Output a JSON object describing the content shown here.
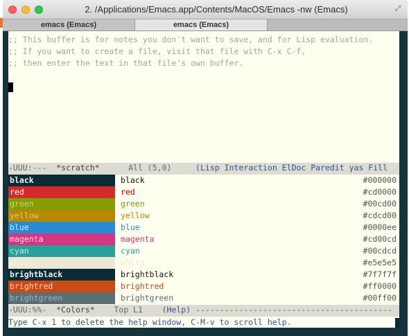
{
  "window": {
    "title": "2. /Applications/Emacs.app/Contents/MacOS/Emacs -nw (Emacs)",
    "tabs": [
      "emacs (Emacs)",
      "emacs (Emacs)"
    ]
  },
  "scratch": {
    "lines": [
      ";; This buffer is for notes you don't want to save, and for Lisp evaluation.",
      ";; If you want to create a file, visit that file with C-x C-f,",
      ";; then enter the text in that file's own buffer."
    ]
  },
  "modeline1": {
    "status": "-UUU:---",
    "buffer": "*scratch*",
    "position": "All (5,0)",
    "modes": "(Lisp Interaction ElDoc Paredit yas Fill"
  },
  "colors": [
    {
      "name": "black",
      "hex": "#000000",
      "swatch_bg": "#0b2a34",
      "swatch_fg": "#eeeeee",
      "text_color": "#111111",
      "bold": true
    },
    {
      "name": "red",
      "hex": "#cd0000",
      "swatch_bg": "#d42a2a",
      "swatch_fg": "#ffffff",
      "text_color": "#cd0000",
      "bold": false
    },
    {
      "name": "green",
      "hex": "#00cd00",
      "swatch_bg": "#859d00",
      "swatch_fg": "#c8d88a",
      "text_color": "#7a9a00",
      "bold": false
    },
    {
      "name": "yellow",
      "hex": "#cdcd00",
      "swatch_bg": "#b68900",
      "swatch_fg": "#e0c880",
      "text_color": "#b58900",
      "bold": false
    },
    {
      "name": "blue",
      "hex": "#0000ee",
      "swatch_bg": "#2a8bd2",
      "swatch_fg": "#d9ecf8",
      "text_color": "#2a8bd2",
      "bold": false
    },
    {
      "name": "magenta",
      "hex": "#cd00cd",
      "swatch_bg": "#d33682",
      "swatch_fg": "#fde0ee",
      "text_color": "#d33682",
      "bold": false
    },
    {
      "name": "cyan",
      "hex": "#00cdcd",
      "swatch_bg": "#2aa198",
      "swatch_fg": "#c8ece8",
      "text_color": "#2aa198",
      "bold": false
    },
    {
      "name": "white",
      "hex": "#e5e5e5",
      "swatch_bg": "#ede8d5",
      "swatch_fg": "#f8f5ea",
      "text_color": "#eee8d5",
      "bold": false
    },
    {
      "name": "brightblack",
      "hex": "#7f7f7f",
      "swatch_bg": "#0b2a34",
      "swatch_fg": "#eeeeee",
      "text_color": "#111111",
      "bold": true
    },
    {
      "name": "brightred",
      "hex": "#ff0000",
      "swatch_bg": "#cb4b16",
      "swatch_fg": "#ffd9c8",
      "text_color": "#cb4b16",
      "bold": false
    },
    {
      "name": "brightgreen",
      "hex": "#00ff00",
      "swatch_bg": "#5a6e73",
      "swatch_fg": "#a5b3b6",
      "text_color": "#586e75",
      "bold": false
    }
  ],
  "modeline2": {
    "status": "-UUU:%%-",
    "buffer": "*Colors*",
    "position": "Top L1",
    "modes": "(Help)",
    "dashes": " -----------------------------------------"
  },
  "echo": "Type C-x 1 to delete the help window, C-M-v to scroll help."
}
